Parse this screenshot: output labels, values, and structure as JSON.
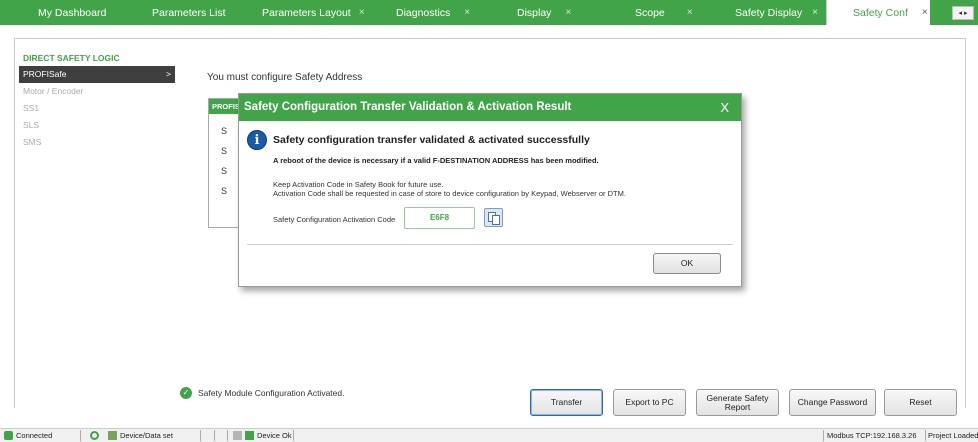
{
  "tabs": [
    {
      "label": "My Dashboard",
      "closable": false
    },
    {
      "label": "Parameters List",
      "closable": false
    },
    {
      "label": "Parameters Layout",
      "closable": true
    },
    {
      "label": "Diagnostics",
      "closable": true
    },
    {
      "label": "Display",
      "closable": true
    },
    {
      "label": "Scope",
      "closable": true
    },
    {
      "label": "Safety Display",
      "closable": true
    },
    {
      "label": "Safety Conf",
      "closable": true,
      "active": true
    }
  ],
  "tab_close_glyph": "×",
  "tab_nav_glyph": "◂ ▸",
  "sidebar": {
    "heading": "DIRECT SAFETY LOGIC",
    "items": [
      {
        "label": "PROFISafe",
        "active": true
      },
      {
        "label": "Motor / Encoder"
      },
      {
        "label": "SS1"
      },
      {
        "label": "SLS"
      },
      {
        "label": "SMS"
      }
    ],
    "active_arrow": ">"
  },
  "main": {
    "configure_msg": "You must configure Safety Address",
    "panel_header": "PROFIS",
    "panel_rows": [
      "S",
      "S",
      "S",
      "S"
    ]
  },
  "dialog": {
    "title": "Safety Configuration Transfer Validation & Activation Result",
    "close_label": "X",
    "headline": "Safety configuration transfer validated & activated successfully",
    "reboot_note": "A reboot of the device is necessary if a valid F-DESTINATION ADDRESS has been modified.",
    "keep_line1": "Keep Activation Code in Safety Book for future use.",
    "keep_line2": "Activation Code shall be requested in case of store to device configuration by Keypad, Webserver or DTM.",
    "code_label": "Safety Configuration Activation Code",
    "code_value": "E6F8",
    "ok_label": "OK",
    "info_glyph": "i"
  },
  "footer": {
    "activated_msg": "Safety Module Configuration Activated.",
    "transfer": "Transfer",
    "export": "Export to PC",
    "generate": "Generate Safety Report",
    "change_password": "Change Password",
    "reset": "Reset"
  },
  "statusbar": {
    "connected": "Connected",
    "device_data_set": "Device/Data set",
    "device_ok": "Device Ok",
    "modbus": "Modbus TCP:192.168.3.26",
    "project": "Project Loaded"
  },
  "colors": {
    "brand_green": "#41a449",
    "dark_nav": "#3f3f3f",
    "info_blue": "#1a5aa8"
  }
}
